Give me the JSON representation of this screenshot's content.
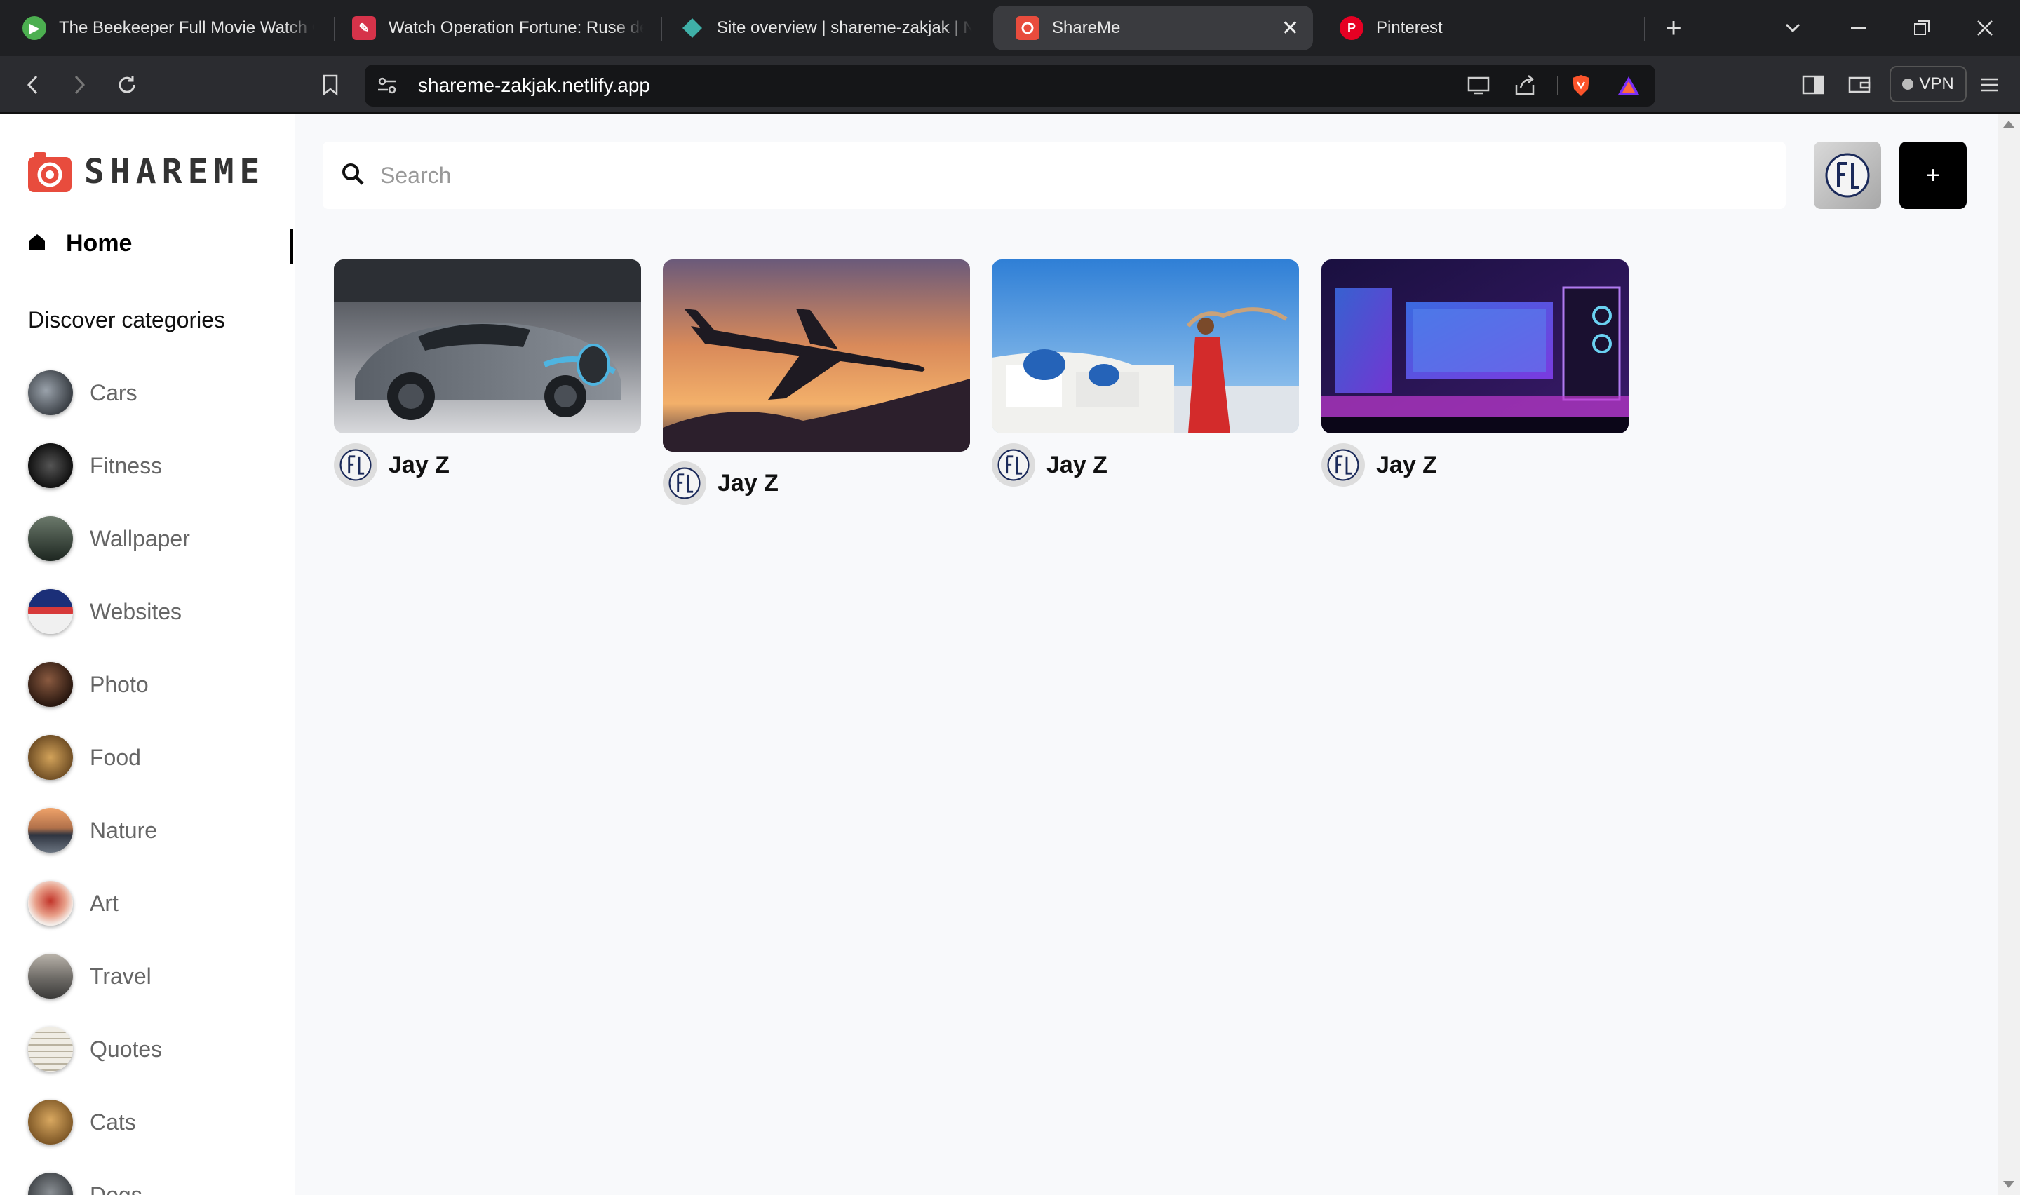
{
  "browser": {
    "tabs": [
      {
        "title": "The Beekeeper Full Movie Watch Online",
        "icon": "play-icon",
        "color": "#4caf50",
        "active": false
      },
      {
        "title": "Watch Operation Fortune: Ruse de guerre",
        "icon": "brush-icon",
        "color": "#d6334a",
        "active": false
      },
      {
        "title": "Site overview | shareme-zakjak | Netlify",
        "icon": "netlify-icon",
        "color": "#3fb0a8",
        "active": false
      },
      {
        "title": "ShareMe",
        "icon": "shareme-icon",
        "color": "#e84c3d",
        "active": true
      },
      {
        "title": "Pinterest",
        "icon": "pinterest-icon",
        "color": "#e60023",
        "active": false
      }
    ],
    "url": "shareme-zakjak.netlify.app",
    "vpn_label": "VPN"
  },
  "sidebar": {
    "logo_text": "SHAREME",
    "home_label": "Home",
    "discover_heading": "Discover categories",
    "categories": [
      {
        "label": "Cars",
        "color": "#5a5f66"
      },
      {
        "label": "Fitness",
        "color": "#2b2b2b"
      },
      {
        "label": "Wallpaper",
        "color": "#3c4a3e"
      },
      {
        "label": "Websites",
        "color": "#2a3c7a"
      },
      {
        "label": "Photo",
        "color": "#4a3026"
      },
      {
        "label": "Food",
        "color": "#8a6a3a"
      },
      {
        "label": "Nature",
        "color": "#b0704a"
      },
      {
        "label": "Art",
        "color": "#c45a3a"
      },
      {
        "label": "Travel",
        "color": "#6d6a66"
      },
      {
        "label": "Quotes",
        "color": "#e8e4da"
      },
      {
        "label": "Cats",
        "color": "#b98a4a"
      },
      {
        "label": "Dogs",
        "color": "#555a5e"
      }
    ]
  },
  "main": {
    "search_placeholder": "Search",
    "add_label": "+",
    "pins": [
      {
        "user": "Jay Z",
        "image": "car"
      },
      {
        "user": "Jay Z",
        "image": "airplane"
      },
      {
        "user": "Jay Z",
        "image": "santorini"
      },
      {
        "user": "Jay Z",
        "image": "gaming-setup"
      }
    ]
  }
}
